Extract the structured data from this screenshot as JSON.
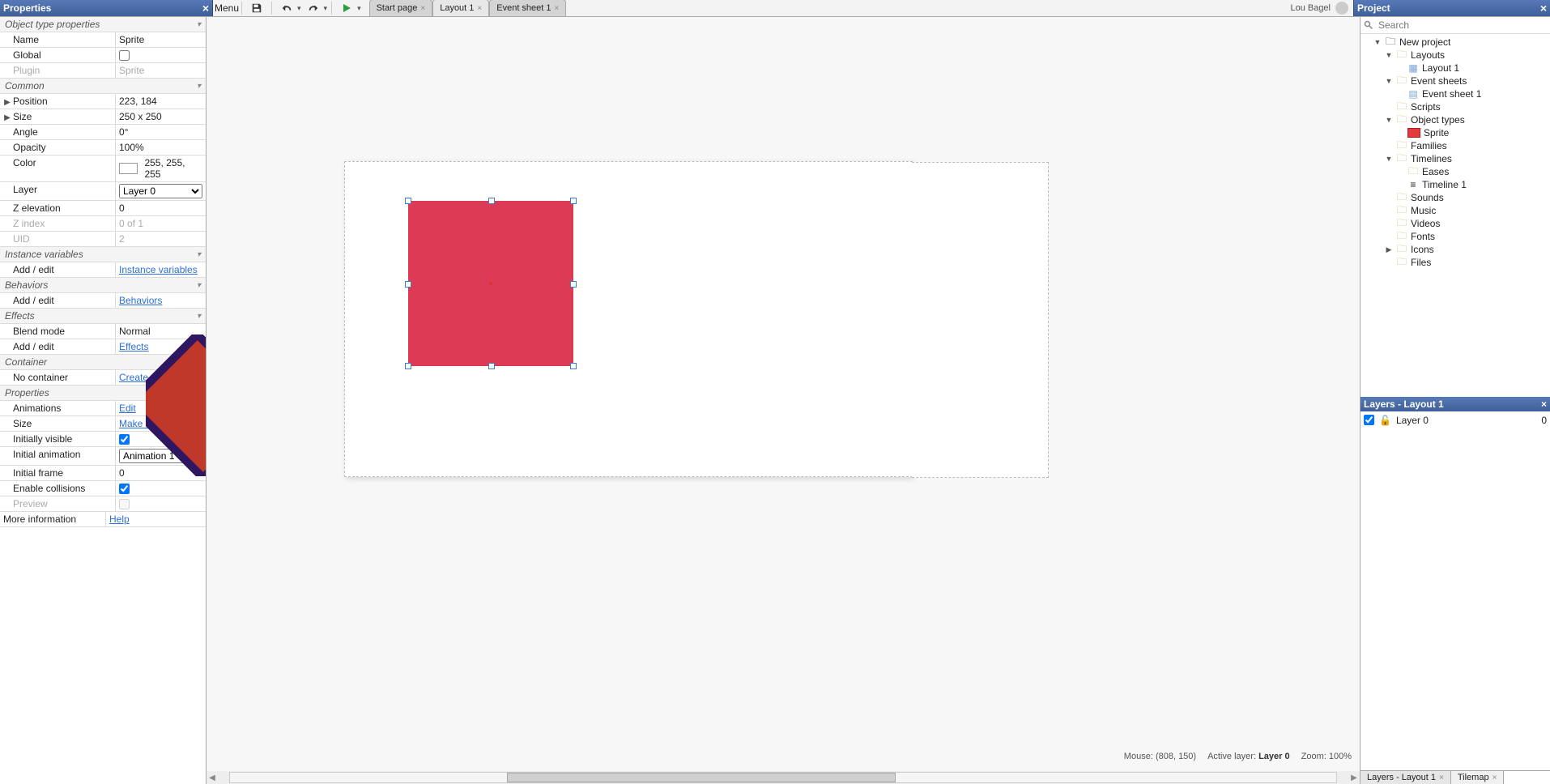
{
  "panels": {
    "properties_title": "Properties",
    "project_title": "Project",
    "layers_title_prefix": "Layers - ",
    "layers_layout": "Layout 1"
  },
  "toolbar": {
    "menu_label": "Menu"
  },
  "user": {
    "name": "Lou Bagel"
  },
  "tabs": [
    {
      "label": "Start page",
      "closable": true,
      "active": false
    },
    {
      "label": "Layout 1",
      "closable": true,
      "active": true
    },
    {
      "label": "Event sheet 1",
      "closable": true,
      "active": false
    }
  ],
  "search": {
    "placeholder": "Search"
  },
  "properties": {
    "sections": {
      "object_type": "Object type properties",
      "common": "Common",
      "instance_vars": "Instance variables",
      "behaviors": "Behaviors",
      "effects": "Effects",
      "container": "Container",
      "props": "Properties"
    },
    "rows": {
      "name_label": "Name",
      "name_value": "Sprite",
      "global_label": "Global",
      "global_checked": false,
      "plugin_label": "Plugin",
      "plugin_value": "Sprite",
      "position_label": "Position",
      "position_value": "223, 184",
      "size_label": "Size",
      "size_value": "250 x 250",
      "angle_label": "Angle",
      "angle_value": "0°",
      "opacity_label": "Opacity",
      "opacity_value": "100%",
      "color_label": "Color",
      "color_value": "255, 255, 255",
      "layer_label": "Layer",
      "layer_value": "Layer 0",
      "zelev_label": "Z elevation",
      "zelev_value": "0",
      "zindex_label": "Z index",
      "zindex_value": "0 of 1",
      "uid_label": "UID",
      "uid_value": "2",
      "addedit_label": "Add / edit",
      "instance_vars_link": "Instance variables",
      "behaviors_link": "Behaviors",
      "blend_label": "Blend mode",
      "blend_value": "Normal",
      "effects_link": "Effects",
      "nocontainer_label": "No container",
      "create_link": "Create",
      "animations_label": "Animations",
      "edit_link": "Edit",
      "size2_label": "Size",
      "make11_link": "Make 1:1",
      "initvis_label": "Initially visible",
      "initvis_checked": true,
      "initanim_label": "Initial animation",
      "initanim_value": "Animation 1",
      "initframe_label": "Initial frame",
      "initframe_value": "0",
      "enablecoll_label": "Enable collisions",
      "enablecoll_checked": true,
      "preview_label": "Preview",
      "preview_checked": false,
      "moreinfo_label": "More information",
      "help_link": "Help"
    }
  },
  "project_tree": {
    "root": "New project",
    "layouts": "Layouts",
    "layout1": "Layout 1",
    "event_sheets": "Event sheets",
    "event_sheet1": "Event sheet 1",
    "scripts": "Scripts",
    "object_types": "Object types",
    "sprite": "Sprite",
    "families": "Families",
    "timelines": "Timelines",
    "eases": "Eases",
    "timeline1": "Timeline 1",
    "sounds": "Sounds",
    "music": "Music",
    "videos": "Videos",
    "fonts": "Fonts",
    "icons": "Icons",
    "files": "Files"
  },
  "layers": {
    "rows": [
      {
        "name": "Layer 0",
        "index": "0",
        "visible": true
      }
    ]
  },
  "bottom_tabs": {
    "layers_label": "Layers - Layout 1",
    "tilemap_label": "Tilemap"
  },
  "status": {
    "mouse_label": "Mouse:",
    "mouse_value": "(808, 150)",
    "active_layer_label": "Active layer:",
    "active_layer_value": "Layer 0",
    "zoom_label": "Zoom:",
    "zoom_value": "100%"
  },
  "colors": {
    "sprite_fill": "#dc3a55"
  }
}
